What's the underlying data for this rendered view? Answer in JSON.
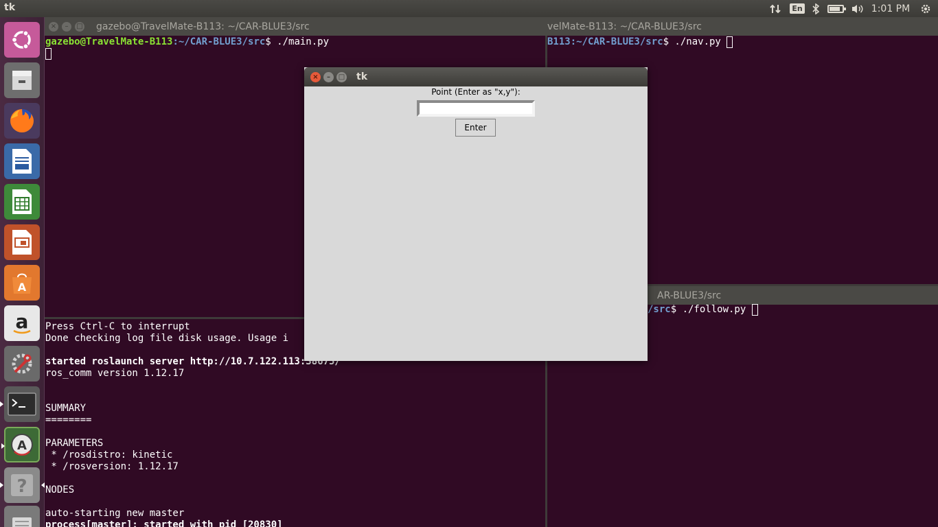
{
  "top_panel": {
    "app_title": "tk",
    "keyboard_layout": "En",
    "battery_level_percent": 85,
    "clock": "1:01 PM",
    "icons": [
      "network-arrows-icon",
      "bluetooth-icon",
      "battery-icon",
      "volume-icon",
      "gear-icon"
    ]
  },
  "launcher": {
    "items": [
      {
        "name": "ubuntu-dash",
        "icon": "ubuntu-logo-icon"
      },
      {
        "name": "files",
        "icon": "file-cabinet-icon"
      },
      {
        "name": "firefox",
        "icon": "firefox-icon"
      },
      {
        "name": "libreoffice-writer",
        "icon": "writer-icon"
      },
      {
        "name": "libreoffice-calc",
        "icon": "calc-icon"
      },
      {
        "name": "libreoffice-impress",
        "icon": "impress-icon"
      },
      {
        "name": "ubuntu-software",
        "icon": "software-center-icon"
      },
      {
        "name": "amazon",
        "icon": "amazon-icon"
      },
      {
        "name": "system-settings",
        "icon": "settings-wrench-icon"
      },
      {
        "name": "terminal",
        "icon": "terminal-icon"
      },
      {
        "name": "software-updater",
        "icon": "software-updater-icon"
      },
      {
        "name": "unknown-app",
        "icon": "question-mark-icon"
      },
      {
        "name": "trash",
        "icon": "trash-icon"
      }
    ]
  },
  "terminal_main": {
    "title": "gazebo@TravelMate-B113: ~/CAR-BLUE3/src",
    "prompt_user": "gazebo@TravelMate-B113",
    "prompt_path": ":~/CAR-BLUE3/src",
    "command": "$ ./main.py"
  },
  "terminal_nav": {
    "title": "velMate-B113: ~/CAR-BLUE3/src",
    "prompt_path_partial": "B113:~/CAR-BLUE3/src",
    "command": "$ ./nav.py "
  },
  "terminal_follow": {
    "title": "AR-BLUE3/src",
    "prompt_path_partial": "/src",
    "command": "$ ./follow.py "
  },
  "terminal_roscore": {
    "lines": [
      {
        "text": "Press Ctrl-C to interrupt",
        "bold": false
      },
      {
        "text": "Done checking log file disk usage. Usage i",
        "bold": false
      },
      {
        "text": "",
        "bold": false
      },
      {
        "text": "started roslaunch server http://10.7.122.113:38675/",
        "bold": true
      },
      {
        "text": "ros_comm version 1.12.17",
        "bold": false
      },
      {
        "text": "",
        "bold": false
      },
      {
        "text": "",
        "bold": false
      },
      {
        "text": "SUMMARY",
        "bold": false
      },
      {
        "text": "========",
        "bold": false
      },
      {
        "text": "",
        "bold": false
      },
      {
        "text": "PARAMETERS",
        "bold": false
      },
      {
        "text": " * /rosdistro: kinetic",
        "bold": false
      },
      {
        "text": " * /rosversion: 1.12.17",
        "bold": false
      },
      {
        "text": "",
        "bold": false
      },
      {
        "text": "NODES",
        "bold": false
      },
      {
        "text": "",
        "bold": false
      },
      {
        "text": "auto-starting new master",
        "bold": false
      },
      {
        "text": "process[master]: started with pid [20830]",
        "bold": true
      }
    ]
  },
  "tk_dialog": {
    "title": "tk",
    "label": "Point (Enter as \"x,y\"):",
    "entry_value": "",
    "button_label": "Enter",
    "close_glyph": "×",
    "minimize_glyph": "–",
    "maximize_glyph": "□"
  },
  "colors": {
    "terminal_bg": "#300a24",
    "prompt_user": "#8ae234",
    "prompt_path": "#729fcf",
    "panel_bg": "#3c3b37",
    "tk_bg": "#d9d9d9",
    "close_button": "#e85a3a"
  }
}
